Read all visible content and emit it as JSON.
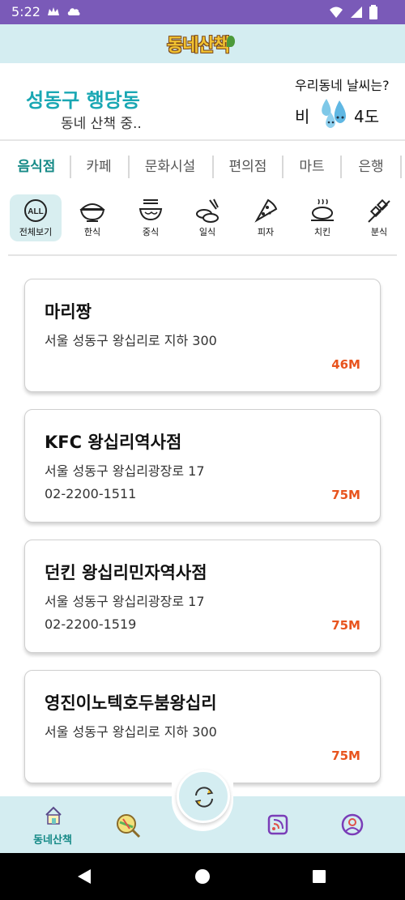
{
  "status": {
    "time": "5:22"
  },
  "header": {
    "logo_text": "동네산책"
  },
  "location": {
    "district": "성동구 행당동",
    "walking_text": "동네 산책 중.."
  },
  "weather": {
    "question": "우리동네 날씨는?",
    "type": "비",
    "temperature": "4도"
  },
  "tabs": [
    {
      "label": "음식점"
    },
    {
      "label": "카페"
    },
    {
      "label": "문화시설"
    },
    {
      "label": "편의점"
    },
    {
      "label": "마트"
    },
    {
      "label": "은행"
    }
  ],
  "categories": [
    {
      "label": "전체보기",
      "icon": "all-icon"
    },
    {
      "label": "한식",
      "icon": "rice-bowl-icon"
    },
    {
      "label": "중식",
      "icon": "noodle-bowl-icon"
    },
    {
      "label": "일식",
      "icon": "sushi-icon"
    },
    {
      "label": "피자",
      "icon": "pizza-icon"
    },
    {
      "label": "치킨",
      "icon": "chicken-icon"
    },
    {
      "label": "분식",
      "icon": "skewer-icon"
    }
  ],
  "places": [
    {
      "name": "마리짱",
      "address": "서울 성동구 왕십리로 지하 300",
      "phone": "",
      "distance": "46M"
    },
    {
      "name": "KFC 왕십리역사점",
      "address": "서울 성동구 왕십리광장로 17",
      "phone": "02-2200-1511",
      "distance": "75M"
    },
    {
      "name": "던킨 왕십리민자역사점",
      "address": "서울 성동구 왕십리광장로 17",
      "phone": "02-2200-1519",
      "distance": "75M"
    },
    {
      "name": "영진이노텍호두붐왕십리",
      "address": "서울 성동구 왕십리로 지하 300",
      "phone": "",
      "distance": "75M"
    }
  ],
  "bottom_nav": {
    "home_label": "동네산책"
  },
  "colors": {
    "accent": "#19a7b3",
    "header_bg": "#d4edf1",
    "status_bar": "#7a5ab8",
    "distance": "#e8541e"
  }
}
